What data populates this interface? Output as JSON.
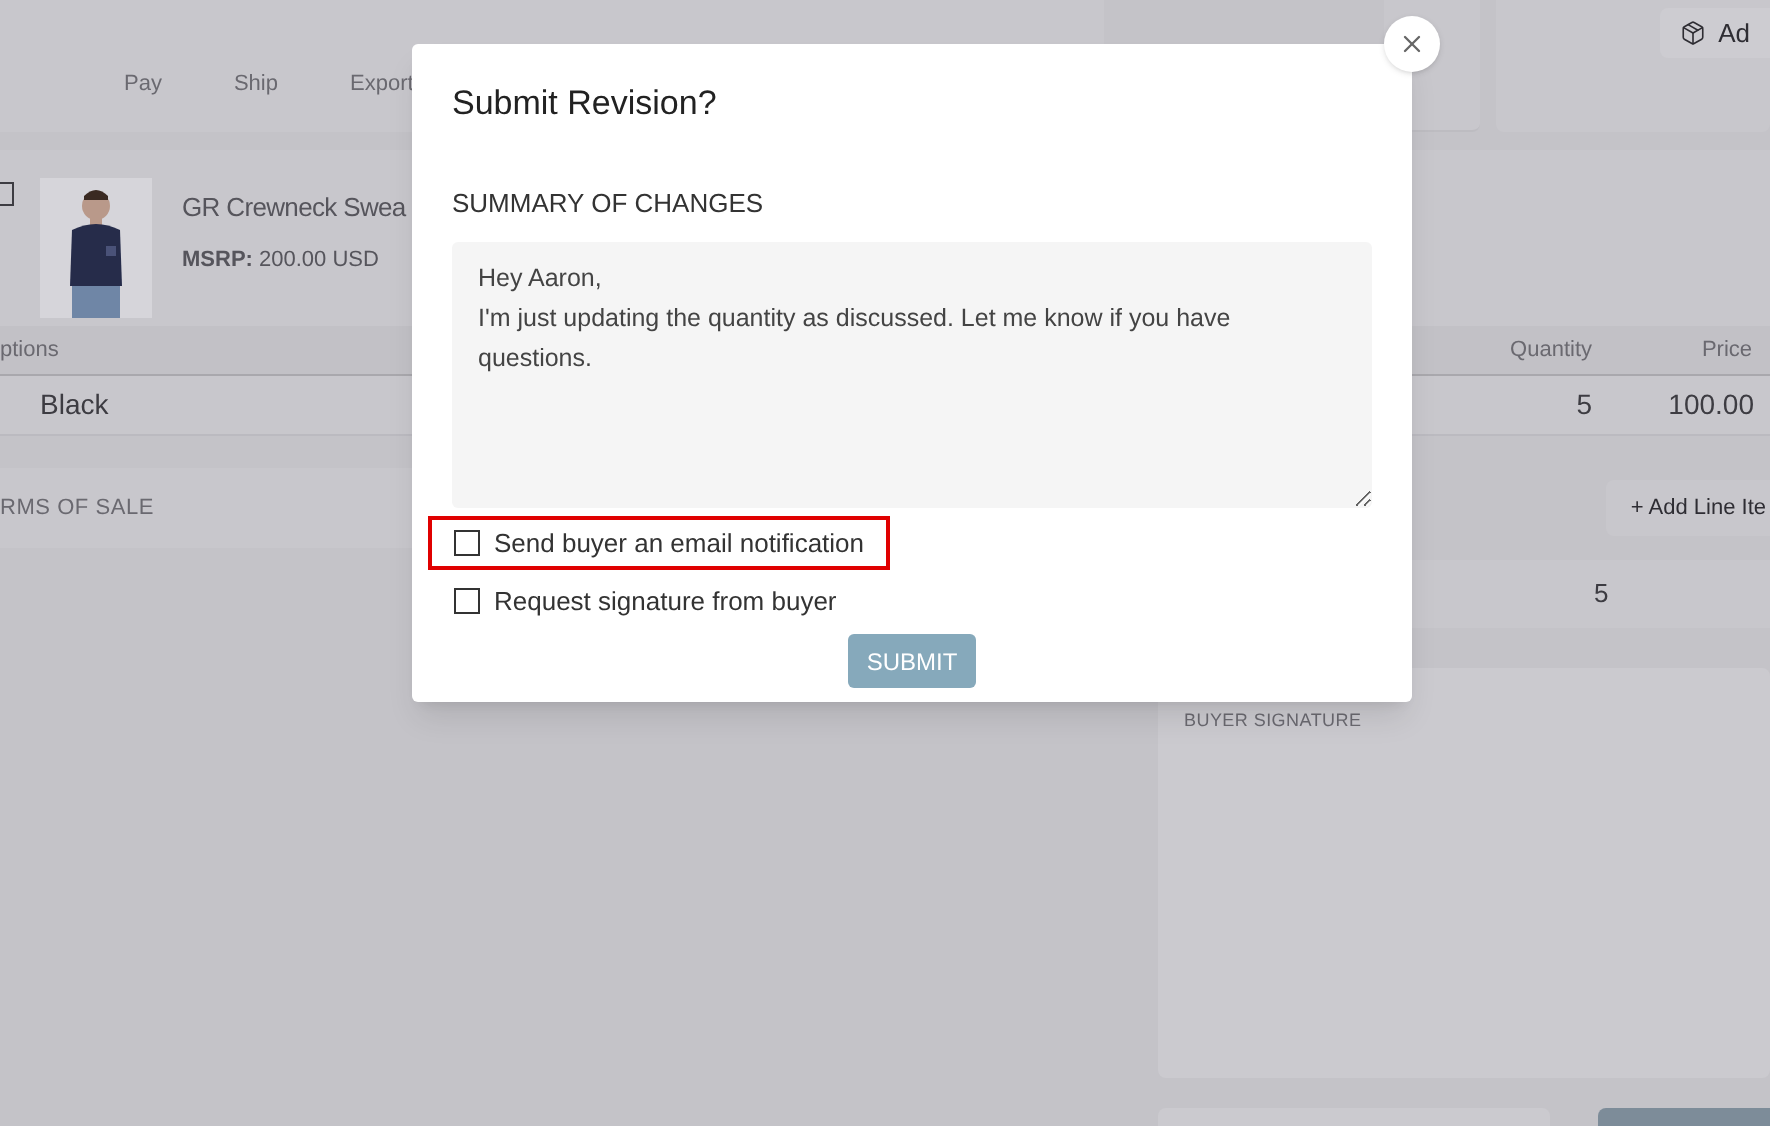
{
  "background": {
    "tabs": [
      "Pay",
      "Ship",
      "Export"
    ],
    "top_button": "Ad",
    "product": {
      "checked": false,
      "name": "GR Crewneck Swea",
      "msrp": "**MSRP:** 200.00 USD"
    },
    "table": {
      "columns": [
        "ptions",
        "Quantity",
        "Price"
      ],
      "rows": [
        {
          "option": "Black",
          "quantity": "5",
          "price": "100.00"
        }
      ]
    },
    "terms_heading": "RMS OF SALE",
    "add_line_button": "+ Add Line Ite",
    "total_quantity": "5",
    "signature_heading": "BUYER SIGNATURE"
  },
  "modal": {
    "title": "Submit Revision?",
    "summary_label": "SUMMARY OF CHANGES",
    "summary_value": "Hey Aaron,\nI'm just updating the quantity as discussed. Let me know if you have questions.",
    "options": [
      {
        "label": "Send buyer an email notification",
        "checked": false,
        "highlighted": true
      },
      {
        "label": "Request signature from buyer",
        "checked": false,
        "highlighted": false
      }
    ],
    "submit": {
      "label": "SUBMIT",
      "disabled": true
    }
  }
}
